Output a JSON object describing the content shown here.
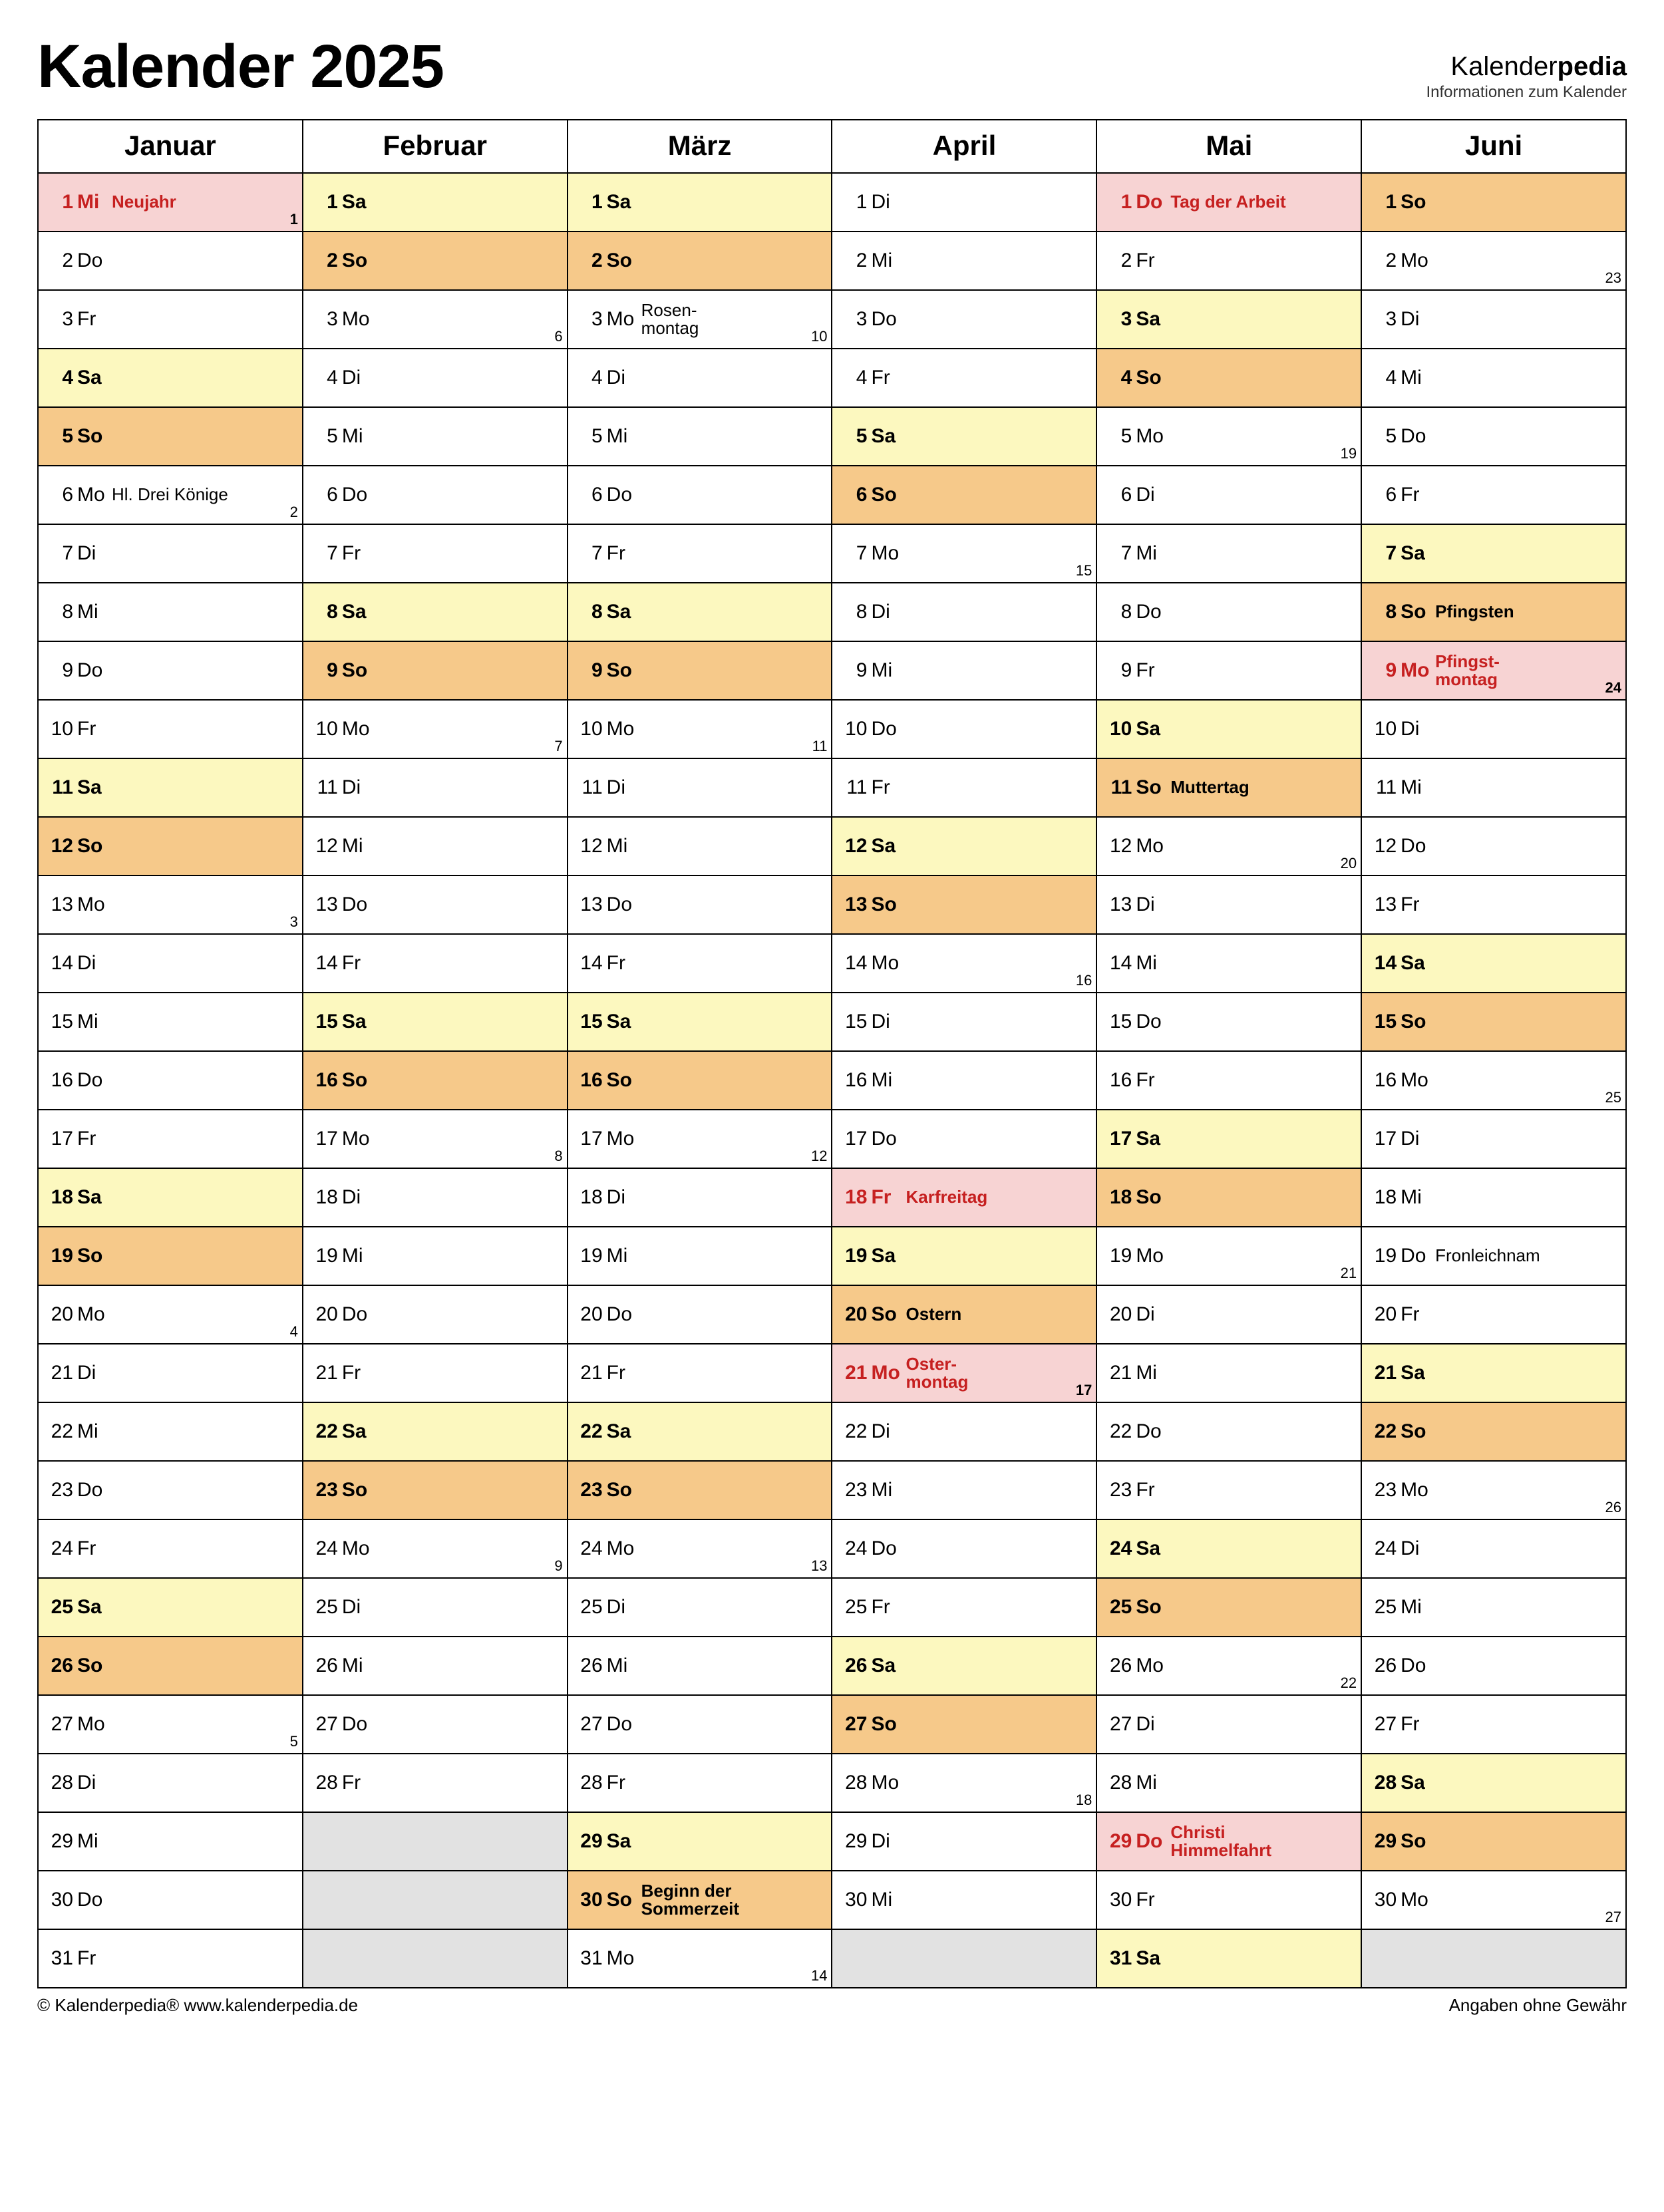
{
  "title": "Kalender 2025",
  "brand": {
    "prefix": "Kalender",
    "suffix": "pedia",
    "tagline": "Informationen zum Kalender"
  },
  "footer": {
    "left": "© Kalenderpedia®    www.kalenderpedia.de",
    "right": "Angaben ohne Gewähr"
  },
  "months": [
    "Januar",
    "Februar",
    "März",
    "April",
    "Mai",
    "Juni"
  ],
  "grid": [
    [
      {
        "d": 1,
        "w": "Mi",
        "t": "hol",
        "e": "Neujahr",
        "k": "1"
      },
      {
        "d": 1,
        "w": "Sa",
        "t": "sat"
      },
      {
        "d": 1,
        "w": "Sa",
        "t": "sat"
      },
      {
        "d": 1,
        "w": "Di"
      },
      {
        "d": 1,
        "w": "Do",
        "t": "hol",
        "e": "Tag der Arbeit"
      },
      {
        "d": 1,
        "w": "So",
        "t": "sun"
      }
    ],
    [
      {
        "d": 2,
        "w": "Do"
      },
      {
        "d": 2,
        "w": "So",
        "t": "sun"
      },
      {
        "d": 2,
        "w": "So",
        "t": "sun"
      },
      {
        "d": 2,
        "w": "Mi"
      },
      {
        "d": 2,
        "w": "Fr"
      },
      {
        "d": 2,
        "w": "Mo",
        "k": "23"
      }
    ],
    [
      {
        "d": 3,
        "w": "Fr"
      },
      {
        "d": 3,
        "w": "Mo",
        "k": "6"
      },
      {
        "d": 3,
        "w": "Mo",
        "e": "Rosen-\nmontag",
        "k": "10"
      },
      {
        "d": 3,
        "w": "Do"
      },
      {
        "d": 3,
        "w": "Sa",
        "t": "sat"
      },
      {
        "d": 3,
        "w": "Di"
      }
    ],
    [
      {
        "d": 4,
        "w": "Sa",
        "t": "sat"
      },
      {
        "d": 4,
        "w": "Di"
      },
      {
        "d": 4,
        "w": "Di"
      },
      {
        "d": 4,
        "w": "Fr"
      },
      {
        "d": 4,
        "w": "So",
        "t": "sun"
      },
      {
        "d": 4,
        "w": "Mi"
      }
    ],
    [
      {
        "d": 5,
        "w": "So",
        "t": "sun"
      },
      {
        "d": 5,
        "w": "Mi"
      },
      {
        "d": 5,
        "w": "Mi"
      },
      {
        "d": 5,
        "w": "Sa",
        "t": "sat"
      },
      {
        "d": 5,
        "w": "Mo",
        "k": "19"
      },
      {
        "d": 5,
        "w": "Do"
      }
    ],
    [
      {
        "d": 6,
        "w": "Mo",
        "e": "Hl. Drei Könige",
        "k": "2"
      },
      {
        "d": 6,
        "w": "Do"
      },
      {
        "d": 6,
        "w": "Do"
      },
      {
        "d": 6,
        "w": "So",
        "t": "sun"
      },
      {
        "d": 6,
        "w": "Di"
      },
      {
        "d": 6,
        "w": "Fr"
      }
    ],
    [
      {
        "d": 7,
        "w": "Di"
      },
      {
        "d": 7,
        "w": "Fr"
      },
      {
        "d": 7,
        "w": "Fr"
      },
      {
        "d": 7,
        "w": "Mo",
        "k": "15"
      },
      {
        "d": 7,
        "w": "Mi"
      },
      {
        "d": 7,
        "w": "Sa",
        "t": "sat"
      }
    ],
    [
      {
        "d": 8,
        "w": "Mi"
      },
      {
        "d": 8,
        "w": "Sa",
        "t": "sat"
      },
      {
        "d": 8,
        "w": "Sa",
        "t": "sat"
      },
      {
        "d": 8,
        "w": "Di"
      },
      {
        "d": 8,
        "w": "Do"
      },
      {
        "d": 8,
        "w": "So",
        "t": "sun",
        "e": "Pfingsten"
      }
    ],
    [
      {
        "d": 9,
        "w": "Do"
      },
      {
        "d": 9,
        "w": "So",
        "t": "sun"
      },
      {
        "d": 9,
        "w": "So",
        "t": "sun"
      },
      {
        "d": 9,
        "w": "Mi"
      },
      {
        "d": 9,
        "w": "Fr"
      },
      {
        "d": 9,
        "w": "Mo",
        "t": "hol",
        "e": "Pfingst-\nmontag",
        "k": "24"
      }
    ],
    [
      {
        "d": 10,
        "w": "Fr"
      },
      {
        "d": 10,
        "w": "Mo",
        "k": "7"
      },
      {
        "d": 10,
        "w": "Mo",
        "k": "11"
      },
      {
        "d": 10,
        "w": "Do"
      },
      {
        "d": 10,
        "w": "Sa",
        "t": "sat"
      },
      {
        "d": 10,
        "w": "Di"
      }
    ],
    [
      {
        "d": 11,
        "w": "Sa",
        "t": "sat"
      },
      {
        "d": 11,
        "w": "Di"
      },
      {
        "d": 11,
        "w": "Di"
      },
      {
        "d": 11,
        "w": "Fr"
      },
      {
        "d": 11,
        "w": "So",
        "t": "sun",
        "e": "Muttertag"
      },
      {
        "d": 11,
        "w": "Mi"
      }
    ],
    [
      {
        "d": 12,
        "w": "So",
        "t": "sun"
      },
      {
        "d": 12,
        "w": "Mi"
      },
      {
        "d": 12,
        "w": "Mi"
      },
      {
        "d": 12,
        "w": "Sa",
        "t": "sat"
      },
      {
        "d": 12,
        "w": "Mo",
        "k": "20"
      },
      {
        "d": 12,
        "w": "Do"
      }
    ],
    [
      {
        "d": 13,
        "w": "Mo",
        "k": "3"
      },
      {
        "d": 13,
        "w": "Do"
      },
      {
        "d": 13,
        "w": "Do"
      },
      {
        "d": 13,
        "w": "So",
        "t": "sun"
      },
      {
        "d": 13,
        "w": "Di"
      },
      {
        "d": 13,
        "w": "Fr"
      }
    ],
    [
      {
        "d": 14,
        "w": "Di"
      },
      {
        "d": 14,
        "w": "Fr"
      },
      {
        "d": 14,
        "w": "Fr"
      },
      {
        "d": 14,
        "w": "Mo",
        "k": "16"
      },
      {
        "d": 14,
        "w": "Mi"
      },
      {
        "d": 14,
        "w": "Sa",
        "t": "sat"
      }
    ],
    [
      {
        "d": 15,
        "w": "Mi"
      },
      {
        "d": 15,
        "w": "Sa",
        "t": "sat"
      },
      {
        "d": 15,
        "w": "Sa",
        "t": "sat"
      },
      {
        "d": 15,
        "w": "Di"
      },
      {
        "d": 15,
        "w": "Do"
      },
      {
        "d": 15,
        "w": "So",
        "t": "sun"
      }
    ],
    [
      {
        "d": 16,
        "w": "Do"
      },
      {
        "d": 16,
        "w": "So",
        "t": "sun"
      },
      {
        "d": 16,
        "w": "So",
        "t": "sun"
      },
      {
        "d": 16,
        "w": "Mi"
      },
      {
        "d": 16,
        "w": "Fr"
      },
      {
        "d": 16,
        "w": "Mo",
        "k": "25"
      }
    ],
    [
      {
        "d": 17,
        "w": "Fr"
      },
      {
        "d": 17,
        "w": "Mo",
        "k": "8"
      },
      {
        "d": 17,
        "w": "Mo",
        "k": "12"
      },
      {
        "d": 17,
        "w": "Do"
      },
      {
        "d": 17,
        "w": "Sa",
        "t": "sat"
      },
      {
        "d": 17,
        "w": "Di"
      }
    ],
    [
      {
        "d": 18,
        "w": "Sa",
        "t": "sat"
      },
      {
        "d": 18,
        "w": "Di"
      },
      {
        "d": 18,
        "w": "Di"
      },
      {
        "d": 18,
        "w": "Fr",
        "t": "hol",
        "e": "Karfreitag"
      },
      {
        "d": 18,
        "w": "So",
        "t": "sun"
      },
      {
        "d": 18,
        "w": "Mi"
      }
    ],
    [
      {
        "d": 19,
        "w": "So",
        "t": "sun"
      },
      {
        "d": 19,
        "w": "Mi"
      },
      {
        "d": 19,
        "w": "Mi"
      },
      {
        "d": 19,
        "w": "Sa",
        "t": "sat"
      },
      {
        "d": 19,
        "w": "Mo",
        "k": "21"
      },
      {
        "d": 19,
        "w": "Do",
        "e": "Fronleichnam"
      }
    ],
    [
      {
        "d": 20,
        "w": "Mo",
        "k": "4"
      },
      {
        "d": 20,
        "w": "Do"
      },
      {
        "d": 20,
        "w": "Do"
      },
      {
        "d": 20,
        "w": "So",
        "t": "sun",
        "e": "Ostern"
      },
      {
        "d": 20,
        "w": "Di"
      },
      {
        "d": 20,
        "w": "Fr"
      }
    ],
    [
      {
        "d": 21,
        "w": "Di"
      },
      {
        "d": 21,
        "w": "Fr"
      },
      {
        "d": 21,
        "w": "Fr"
      },
      {
        "d": 21,
        "w": "Mo",
        "t": "hol",
        "e": "Oster-\nmontag",
        "k": "17"
      },
      {
        "d": 21,
        "w": "Mi"
      },
      {
        "d": 21,
        "w": "Sa",
        "t": "sat"
      }
    ],
    [
      {
        "d": 22,
        "w": "Mi"
      },
      {
        "d": 22,
        "w": "Sa",
        "t": "sat"
      },
      {
        "d": 22,
        "w": "Sa",
        "t": "sat"
      },
      {
        "d": 22,
        "w": "Di"
      },
      {
        "d": 22,
        "w": "Do"
      },
      {
        "d": 22,
        "w": "So",
        "t": "sun"
      }
    ],
    [
      {
        "d": 23,
        "w": "Do"
      },
      {
        "d": 23,
        "w": "So",
        "t": "sun"
      },
      {
        "d": 23,
        "w": "So",
        "t": "sun"
      },
      {
        "d": 23,
        "w": "Mi"
      },
      {
        "d": 23,
        "w": "Fr"
      },
      {
        "d": 23,
        "w": "Mo",
        "k": "26"
      }
    ],
    [
      {
        "d": 24,
        "w": "Fr"
      },
      {
        "d": 24,
        "w": "Mo",
        "k": "9"
      },
      {
        "d": 24,
        "w": "Mo",
        "k": "13"
      },
      {
        "d": 24,
        "w": "Do"
      },
      {
        "d": 24,
        "w": "Sa",
        "t": "sat"
      },
      {
        "d": 24,
        "w": "Di"
      }
    ],
    [
      {
        "d": 25,
        "w": "Sa",
        "t": "sat"
      },
      {
        "d": 25,
        "w": "Di"
      },
      {
        "d": 25,
        "w": "Di"
      },
      {
        "d": 25,
        "w": "Fr"
      },
      {
        "d": 25,
        "w": "So",
        "t": "sun"
      },
      {
        "d": 25,
        "w": "Mi"
      }
    ],
    [
      {
        "d": 26,
        "w": "So",
        "t": "sun"
      },
      {
        "d": 26,
        "w": "Mi"
      },
      {
        "d": 26,
        "w": "Mi"
      },
      {
        "d": 26,
        "w": "Sa",
        "t": "sat"
      },
      {
        "d": 26,
        "w": "Mo",
        "k": "22"
      },
      {
        "d": 26,
        "w": "Do"
      }
    ],
    [
      {
        "d": 27,
        "w": "Mo",
        "k": "5"
      },
      {
        "d": 27,
        "w": "Do"
      },
      {
        "d": 27,
        "w": "Do"
      },
      {
        "d": 27,
        "w": "So",
        "t": "sun"
      },
      {
        "d": 27,
        "w": "Di"
      },
      {
        "d": 27,
        "w": "Fr"
      }
    ],
    [
      {
        "d": 28,
        "w": "Di"
      },
      {
        "d": 28,
        "w": "Fr"
      },
      {
        "d": 28,
        "w": "Fr"
      },
      {
        "d": 28,
        "w": "Mo",
        "k": "18"
      },
      {
        "d": 28,
        "w": "Mi"
      },
      {
        "d": 28,
        "w": "Sa",
        "t": "sat"
      }
    ],
    [
      {
        "d": 29,
        "w": "Mi"
      },
      {
        "blank": true
      },
      {
        "d": 29,
        "w": "Sa",
        "t": "sat"
      },
      {
        "d": 29,
        "w": "Di"
      },
      {
        "d": 29,
        "w": "Do",
        "t": "hol",
        "e": "Christi Himmelfahrt"
      },
      {
        "d": 29,
        "w": "So",
        "t": "sun"
      }
    ],
    [
      {
        "d": 30,
        "w": "Do"
      },
      {
        "blank": true
      },
      {
        "d": 30,
        "w": "So",
        "t": "sun",
        "e": "Beginn der Sommerzeit"
      },
      {
        "d": 30,
        "w": "Mi"
      },
      {
        "d": 30,
        "w": "Fr"
      },
      {
        "d": 30,
        "w": "Mo",
        "k": "27"
      }
    ],
    [
      {
        "d": 31,
        "w": "Fr"
      },
      {
        "blank": true
      },
      {
        "d": 31,
        "w": "Mo",
        "k": "14"
      },
      {
        "blank": true
      },
      {
        "d": 31,
        "w": "Sa",
        "t": "sat"
      },
      {
        "blank": true
      }
    ]
  ]
}
